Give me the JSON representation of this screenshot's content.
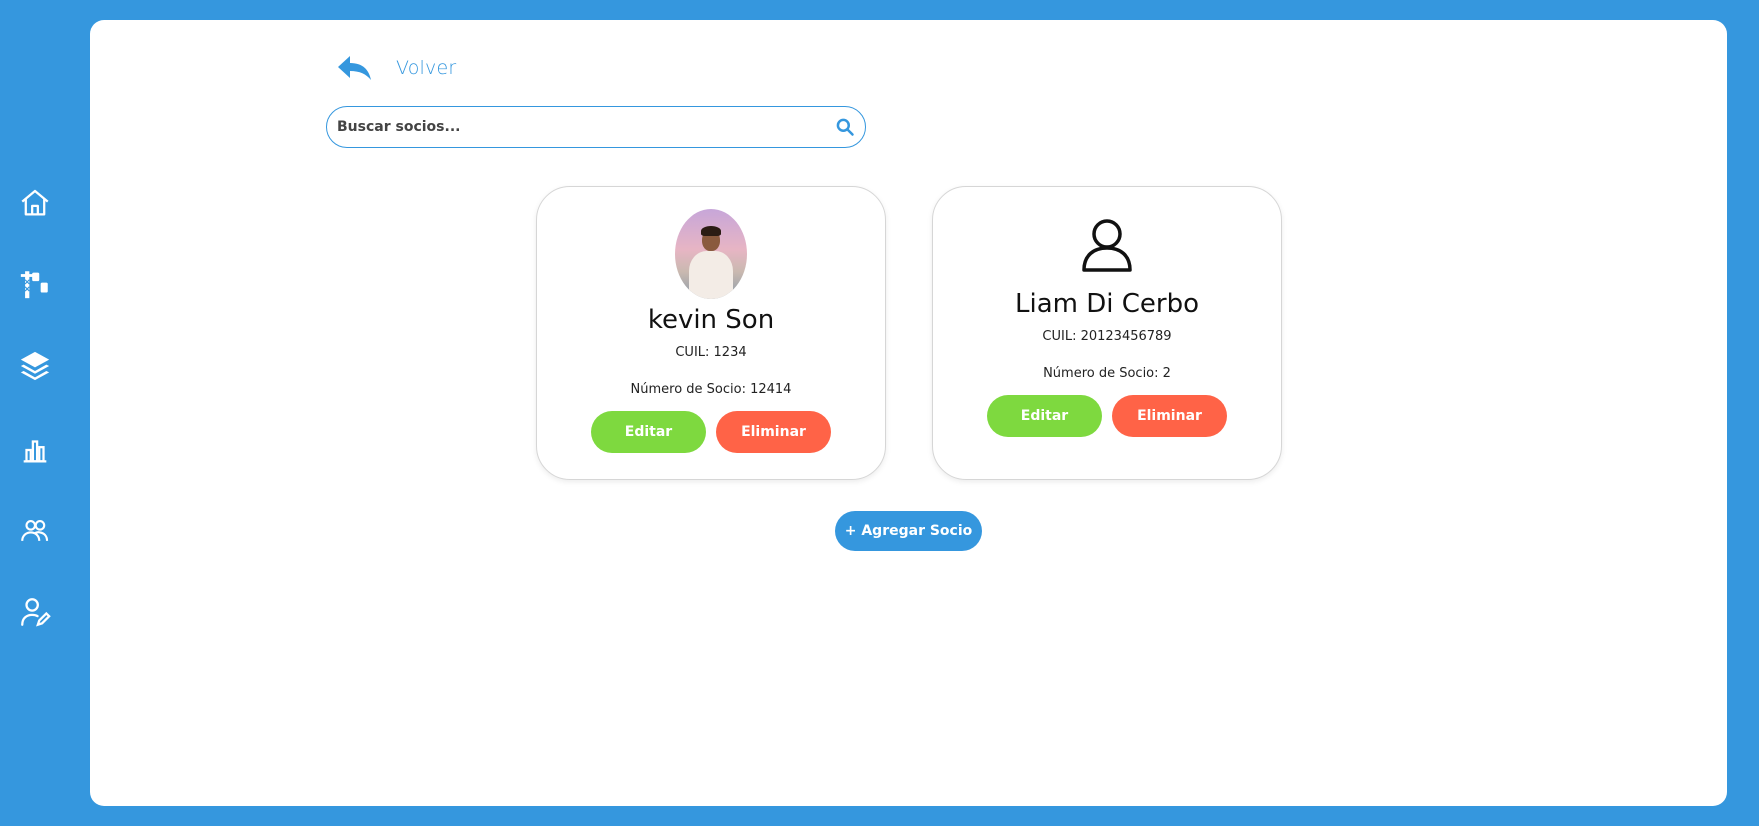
{
  "sidebar": {
    "items": [
      {
        "icon": "home-icon"
      },
      {
        "icon": "crane-icon"
      },
      {
        "icon": "layers-icon"
      },
      {
        "icon": "bar-chart-icon"
      },
      {
        "icon": "users-icon"
      },
      {
        "icon": "user-edit-icon"
      }
    ]
  },
  "header": {
    "back_label": "Volver"
  },
  "search": {
    "placeholder": "Buscar socios...",
    "value": ""
  },
  "members": [
    {
      "name": "kevin Son",
      "cuil": "CUIL: 1234",
      "numero": "Número de Socio: 12414",
      "avatar": "photo",
      "edit_label": "Editar",
      "delete_label": "Eliminar"
    },
    {
      "name": "Liam Di Cerbo",
      "cuil": "CUIL: 20123456789",
      "numero": "Número de Socio: 2",
      "avatar": "user-outline-icon",
      "edit_label": "Editar",
      "delete_label": "Eliminar"
    }
  ],
  "add_member_label": "+ Agregar Socio",
  "colors": {
    "accent": "#3597de",
    "edit": "#7ed93f",
    "delete": "#ff6347",
    "background": "#ffffff"
  }
}
